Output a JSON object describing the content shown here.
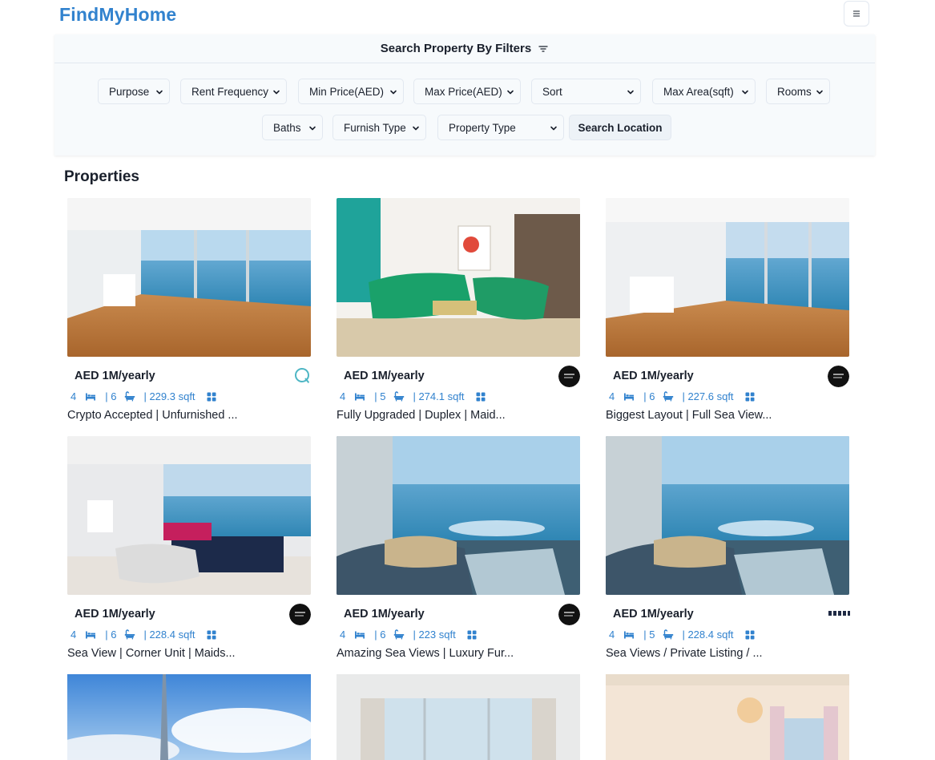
{
  "app": {
    "title": "FindMyHome"
  },
  "navbar": {
    "menu_icon": "hamburger-icon"
  },
  "filters": {
    "title": "Search Property By Filters",
    "title_icon": "filter-icon",
    "purpose": "Purpose",
    "rent_frequency": "Rent Frequency",
    "min_price": "Min Price(AED)",
    "max_price": "Max Price(AED)",
    "sort": "Sort",
    "max_area": "Max Area(sqft)",
    "rooms": "Rooms",
    "baths": "Baths",
    "furnish_type": "Furnish Type",
    "property_type": "Property Type",
    "search_location": "Search Location"
  },
  "section": {
    "title": "Properties"
  },
  "properties": [
    {
      "price": "AED 1M/yearly",
      "rooms": "4",
      "baths": "| 6",
      "area": "| 229.3 sqft",
      "title": "Crypto Accepted | Unfurnished ...",
      "agency_logo": "agency-q-logo"
    },
    {
      "price": "AED 1M/yearly",
      "rooms": "4",
      "baths": "| 5",
      "area": "| 274.1 sqft",
      "title": "Fully Upgraded | Duplex | Maid...",
      "agency_logo": "agency-luxury-logo"
    },
    {
      "price": "AED 1M/yearly",
      "rooms": "4",
      "baths": "| 6",
      "area": "| 227.6 sqft",
      "title": "Biggest Layout | Full Sea View...",
      "agency_logo": "agency-luxury-logo"
    },
    {
      "price": "AED 1M/yearly",
      "rooms": "4",
      "baths": "| 6",
      "area": "| 228.4 sqft",
      "title": "Sea View | Corner Unit | Maids...",
      "agency_logo": "agency-luxury-logo"
    },
    {
      "price": "AED 1M/yearly",
      "rooms": "4",
      "baths": "| 6",
      "area": "| 223 sqft",
      "title": "Amazing Sea Views | Luxury Fur...",
      "agency_logo": "agency-luxury-logo"
    },
    {
      "price": "AED 1M/yearly",
      "rooms": "4",
      "baths": "| 5",
      "area": "| 228.4 sqft",
      "title": "Sea Views / Private Listing / ...",
      "agency_logo": "agency-dacha-logo"
    }
  ],
  "colors": {
    "brand": "#3182ce",
    "panel": "#f7fafc",
    "border": "#e2e8f0"
  }
}
